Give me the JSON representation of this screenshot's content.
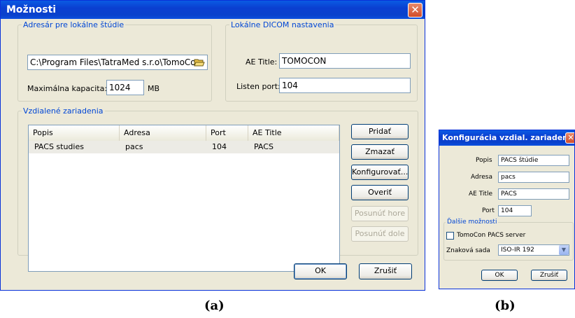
{
  "options_dialog": {
    "title": "Možnosti",
    "local_dir_group": "Adresár pre lokálne štúdie",
    "local_dir_value": "C:\\Program Files\\TatraMed s.r.o\\TomoCon",
    "capacity_label": "Maximálna kapacita:",
    "capacity_value": "1024",
    "capacity_unit": "MB",
    "dicom_group": "Lokálne DICOM nastavenia",
    "ae_title_label": "AE Title:",
    "ae_title_value": "TOMOCON",
    "listen_port_label": "Listen port:",
    "listen_port_value": "104",
    "remote_group": "Vzdialené zariadenia",
    "columns": [
      "Popis",
      "Adresa",
      "Port",
      "AE Title"
    ],
    "rows": [
      {
        "popis": "PACS studies",
        "adresa": "pacs",
        "port": "104",
        "ae_title": "PACS"
      }
    ],
    "buttons": {
      "add": "Pridať",
      "delete": "Zmazať",
      "configure": "Konfigurovať...",
      "verify": "Overiť",
      "move_up": "Posunúť hore",
      "move_down": "Posunúť dole",
      "ok": "OK",
      "cancel": "Zrušiť"
    }
  },
  "config_dialog": {
    "title": "Konfigurácia vzdial. zariadenia",
    "popis_label": "Popis",
    "popis_value": "PACS štúdie",
    "adresa_label": "Adresa",
    "adresa_value": "pacs",
    "ae_title_label": "AE Title",
    "ae_title_value": "PACS",
    "port_label": "Port",
    "port_value": "104",
    "more_group": "Ďalšie možnosti",
    "checkbox_label": "TomoCon PACS server",
    "checkbox_checked": false,
    "charset_label": "Znaková sada",
    "charset_value": "ISO-IR 192",
    "ok": "OK",
    "cancel": "Zrušiť"
  },
  "captions": {
    "a": "(a)",
    "b": "(b)"
  }
}
